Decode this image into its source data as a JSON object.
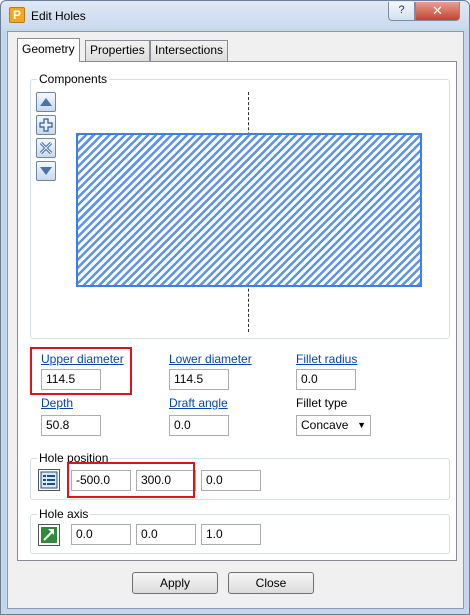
{
  "window": {
    "title": "Edit Holes",
    "app_icon_letter": "P",
    "help_label": "?",
    "close_label": "✕"
  },
  "tabs": [
    {
      "label": "Geometry",
      "active": true
    },
    {
      "label": "Properties",
      "active": false
    },
    {
      "label": "Intersections",
      "active": false
    }
  ],
  "components": {
    "label": "Components",
    "buttons": [
      "move-up-icon",
      "add-icon",
      "delete-icon",
      "move-down-icon"
    ]
  },
  "fields": {
    "upper_diameter": {
      "label": "Upper diameter",
      "value": "114.5"
    },
    "lower_diameter": {
      "label": "Lower diameter",
      "value": "114.5"
    },
    "fillet_radius": {
      "label": "Fillet radius",
      "value": "0.0"
    },
    "depth": {
      "label": "Depth",
      "value": "50.8"
    },
    "draft_angle": {
      "label": "Draft angle",
      "value": "0.0"
    },
    "fillet_type": {
      "label": "Fillet type",
      "value": "Concave"
    }
  },
  "hole_position": {
    "label": "Hole position",
    "x": "-500.0",
    "y": "300.0",
    "z": "0.0"
  },
  "hole_axis": {
    "label": "Hole axis",
    "x": "0.0",
    "y": "0.0",
    "z": "1.0"
  },
  "footer": {
    "apply_label": "Apply",
    "close_label": "Close"
  },
  "colors": {
    "highlight": "#e0121a",
    "hatch": "#5b93ee",
    "link": "#0645ad"
  }
}
